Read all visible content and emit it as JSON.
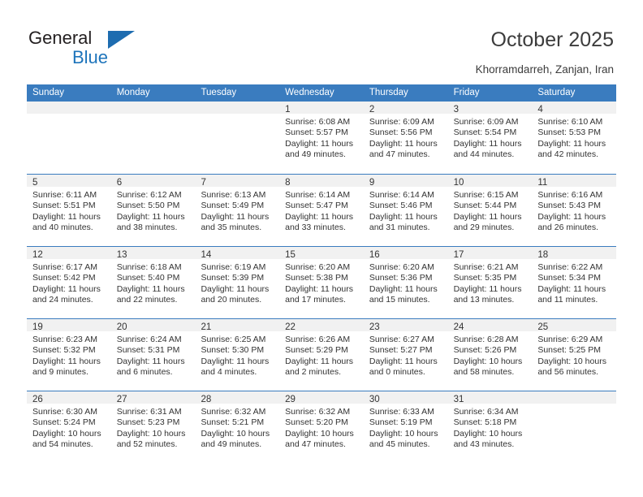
{
  "brand": {
    "name_part1": "General",
    "name_part2": "Blue",
    "accent_color": "#1d6cb0"
  },
  "header": {
    "title": "October 2025",
    "location": "Khorramdarreh, Zanjan, Iran"
  },
  "calendar": {
    "header_bg": "#3a7cbf",
    "daynum_band_bg": "#f1f1f1",
    "weekdays": [
      "Sunday",
      "Monday",
      "Tuesday",
      "Wednesday",
      "Thursday",
      "Friday",
      "Saturday"
    ],
    "weeks": [
      [
        {
          "day": "",
          "sunrise": "",
          "sunset": "",
          "daylight": "",
          "empty": true
        },
        {
          "day": "",
          "sunrise": "",
          "sunset": "",
          "daylight": "",
          "empty": true
        },
        {
          "day": "",
          "sunrise": "",
          "sunset": "",
          "daylight": "",
          "empty": true
        },
        {
          "day": "1",
          "sunrise": "Sunrise: 6:08 AM",
          "sunset": "Sunset: 5:57 PM",
          "daylight": "Daylight: 11 hours and 49 minutes."
        },
        {
          "day": "2",
          "sunrise": "Sunrise: 6:09 AM",
          "sunset": "Sunset: 5:56 PM",
          "daylight": "Daylight: 11 hours and 47 minutes."
        },
        {
          "day": "3",
          "sunrise": "Sunrise: 6:09 AM",
          "sunset": "Sunset: 5:54 PM",
          "daylight": "Daylight: 11 hours and 44 minutes."
        },
        {
          "day": "4",
          "sunrise": "Sunrise: 6:10 AM",
          "sunset": "Sunset: 5:53 PM",
          "daylight": "Daylight: 11 hours and 42 minutes."
        }
      ],
      [
        {
          "day": "5",
          "sunrise": "Sunrise: 6:11 AM",
          "sunset": "Sunset: 5:51 PM",
          "daylight": "Daylight: 11 hours and 40 minutes."
        },
        {
          "day": "6",
          "sunrise": "Sunrise: 6:12 AM",
          "sunset": "Sunset: 5:50 PM",
          "daylight": "Daylight: 11 hours and 38 minutes."
        },
        {
          "day": "7",
          "sunrise": "Sunrise: 6:13 AM",
          "sunset": "Sunset: 5:49 PM",
          "daylight": "Daylight: 11 hours and 35 minutes."
        },
        {
          "day": "8",
          "sunrise": "Sunrise: 6:14 AM",
          "sunset": "Sunset: 5:47 PM",
          "daylight": "Daylight: 11 hours and 33 minutes."
        },
        {
          "day": "9",
          "sunrise": "Sunrise: 6:14 AM",
          "sunset": "Sunset: 5:46 PM",
          "daylight": "Daylight: 11 hours and 31 minutes."
        },
        {
          "day": "10",
          "sunrise": "Sunrise: 6:15 AM",
          "sunset": "Sunset: 5:44 PM",
          "daylight": "Daylight: 11 hours and 29 minutes."
        },
        {
          "day": "11",
          "sunrise": "Sunrise: 6:16 AM",
          "sunset": "Sunset: 5:43 PM",
          "daylight": "Daylight: 11 hours and 26 minutes."
        }
      ],
      [
        {
          "day": "12",
          "sunrise": "Sunrise: 6:17 AM",
          "sunset": "Sunset: 5:42 PM",
          "daylight": "Daylight: 11 hours and 24 minutes."
        },
        {
          "day": "13",
          "sunrise": "Sunrise: 6:18 AM",
          "sunset": "Sunset: 5:40 PM",
          "daylight": "Daylight: 11 hours and 22 minutes."
        },
        {
          "day": "14",
          "sunrise": "Sunrise: 6:19 AM",
          "sunset": "Sunset: 5:39 PM",
          "daylight": "Daylight: 11 hours and 20 minutes."
        },
        {
          "day": "15",
          "sunrise": "Sunrise: 6:20 AM",
          "sunset": "Sunset: 5:38 PM",
          "daylight": "Daylight: 11 hours and 17 minutes."
        },
        {
          "day": "16",
          "sunrise": "Sunrise: 6:20 AM",
          "sunset": "Sunset: 5:36 PM",
          "daylight": "Daylight: 11 hours and 15 minutes."
        },
        {
          "day": "17",
          "sunrise": "Sunrise: 6:21 AM",
          "sunset": "Sunset: 5:35 PM",
          "daylight": "Daylight: 11 hours and 13 minutes."
        },
        {
          "day": "18",
          "sunrise": "Sunrise: 6:22 AM",
          "sunset": "Sunset: 5:34 PM",
          "daylight": "Daylight: 11 hours and 11 minutes."
        }
      ],
      [
        {
          "day": "19",
          "sunrise": "Sunrise: 6:23 AM",
          "sunset": "Sunset: 5:32 PM",
          "daylight": "Daylight: 11 hours and 9 minutes."
        },
        {
          "day": "20",
          "sunrise": "Sunrise: 6:24 AM",
          "sunset": "Sunset: 5:31 PM",
          "daylight": "Daylight: 11 hours and 6 minutes."
        },
        {
          "day": "21",
          "sunrise": "Sunrise: 6:25 AM",
          "sunset": "Sunset: 5:30 PM",
          "daylight": "Daylight: 11 hours and 4 minutes."
        },
        {
          "day": "22",
          "sunrise": "Sunrise: 6:26 AM",
          "sunset": "Sunset: 5:29 PM",
          "daylight": "Daylight: 11 hours and 2 minutes."
        },
        {
          "day": "23",
          "sunrise": "Sunrise: 6:27 AM",
          "sunset": "Sunset: 5:27 PM",
          "daylight": "Daylight: 11 hours and 0 minutes."
        },
        {
          "day": "24",
          "sunrise": "Sunrise: 6:28 AM",
          "sunset": "Sunset: 5:26 PM",
          "daylight": "Daylight: 10 hours and 58 minutes."
        },
        {
          "day": "25",
          "sunrise": "Sunrise: 6:29 AM",
          "sunset": "Sunset: 5:25 PM",
          "daylight": "Daylight: 10 hours and 56 minutes."
        }
      ],
      [
        {
          "day": "26",
          "sunrise": "Sunrise: 6:30 AM",
          "sunset": "Sunset: 5:24 PM",
          "daylight": "Daylight: 10 hours and 54 minutes."
        },
        {
          "day": "27",
          "sunrise": "Sunrise: 6:31 AM",
          "sunset": "Sunset: 5:23 PM",
          "daylight": "Daylight: 10 hours and 52 minutes."
        },
        {
          "day": "28",
          "sunrise": "Sunrise: 6:32 AM",
          "sunset": "Sunset: 5:21 PM",
          "daylight": "Daylight: 10 hours and 49 minutes."
        },
        {
          "day": "29",
          "sunrise": "Sunrise: 6:32 AM",
          "sunset": "Sunset: 5:20 PM",
          "daylight": "Daylight: 10 hours and 47 minutes."
        },
        {
          "day": "30",
          "sunrise": "Sunrise: 6:33 AM",
          "sunset": "Sunset: 5:19 PM",
          "daylight": "Daylight: 10 hours and 45 minutes."
        },
        {
          "day": "31",
          "sunrise": "Sunrise: 6:34 AM",
          "sunset": "Sunset: 5:18 PM",
          "daylight": "Daylight: 10 hours and 43 minutes."
        },
        {
          "day": "",
          "sunrise": "",
          "sunset": "",
          "daylight": "",
          "empty": true
        }
      ]
    ]
  }
}
